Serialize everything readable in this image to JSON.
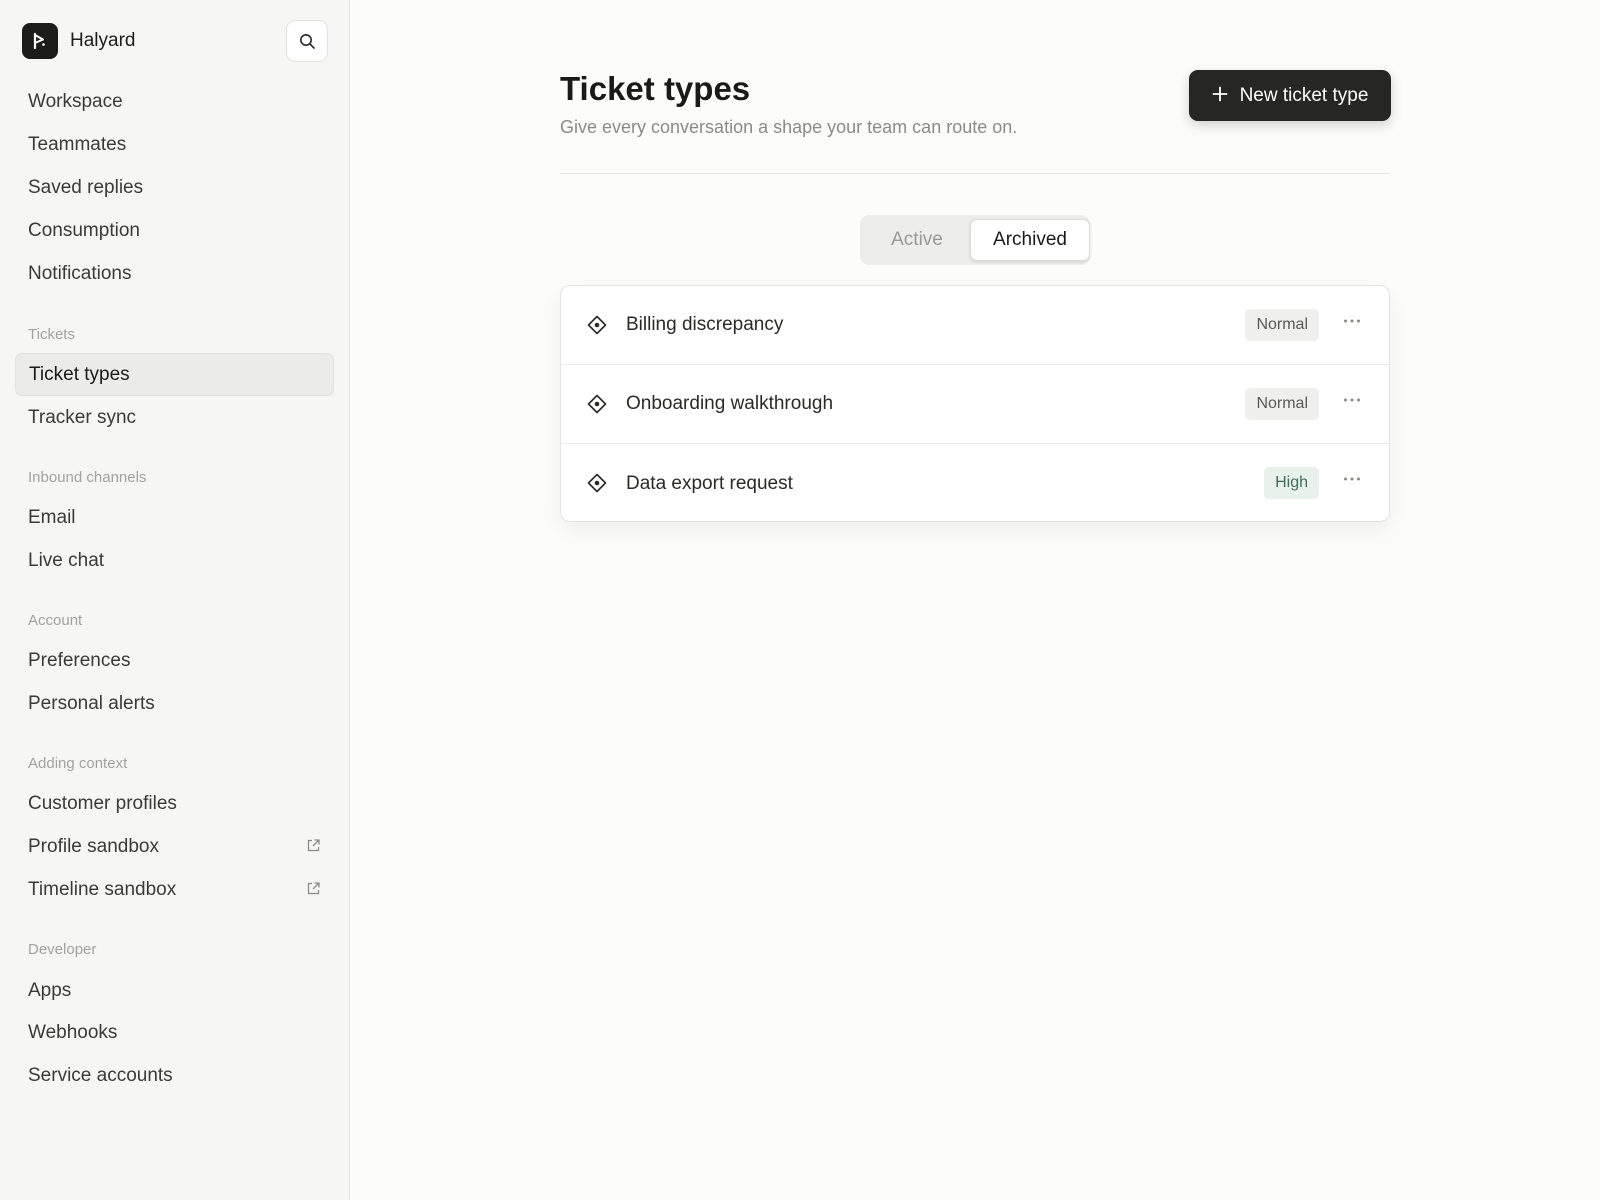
{
  "app": {
    "name": "Halyard"
  },
  "sidebar": {
    "top_items": [
      {
        "label": "Workspace"
      },
      {
        "label": "Teammates"
      },
      {
        "label": "Saved replies"
      },
      {
        "label": "Consumption"
      },
      {
        "label": "Notifications"
      }
    ],
    "sections": [
      {
        "label": "Tickets",
        "items": [
          {
            "label": "Ticket types",
            "active": true
          },
          {
            "label": "Tracker sync"
          }
        ]
      },
      {
        "label": "Inbound channels",
        "items": [
          {
            "label": "Email"
          },
          {
            "label": "Live chat"
          }
        ]
      },
      {
        "label": "Account",
        "items": [
          {
            "label": "Preferences"
          },
          {
            "label": "Personal alerts"
          }
        ]
      },
      {
        "label": "Adding context",
        "items": [
          {
            "label": "Customer profiles"
          },
          {
            "label": "Profile sandbox",
            "external": true
          },
          {
            "label": "Timeline sandbox",
            "external": true
          }
        ]
      },
      {
        "label": "Developer",
        "items": [
          {
            "label": "Apps"
          },
          {
            "label": "Webhooks"
          },
          {
            "label": "Service accounts"
          }
        ]
      }
    ]
  },
  "main": {
    "title": "Ticket types",
    "subtitle": "Give every conversation a shape your team can route on.",
    "new_button": "New ticket type",
    "tabs": [
      {
        "label": "Active",
        "selected": false
      },
      {
        "label": "Archived",
        "selected": true
      }
    ],
    "rows": [
      {
        "title": "Billing discrepancy",
        "priority": "Normal"
      },
      {
        "title": "Onboarding walkthrough",
        "priority": "Normal"
      },
      {
        "title": "Data export request",
        "priority": "High"
      }
    ]
  },
  "icons": {
    "search": "search-icon",
    "plus": "plus-icon",
    "ticket": "ticket-type-icon",
    "more": "more-icon",
    "external": "external-link-icon"
  },
  "colors": {
    "accent": "#262624",
    "high_badge_bg": "#e8f1ec",
    "high_badge_text": "#3e6f56",
    "normal_badge_bg": "#efefec"
  }
}
